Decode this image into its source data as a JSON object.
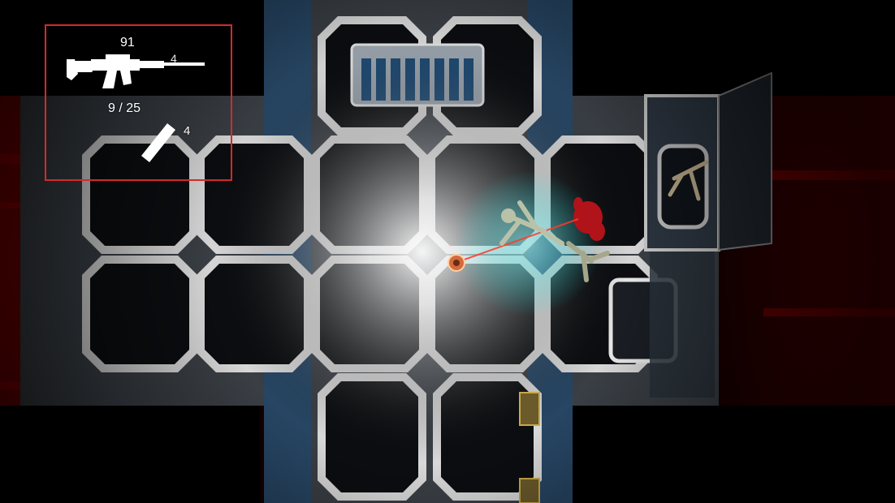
{
  "hud": {
    "reserve_ammo": "91",
    "primary_weapon_count": "4",
    "clip_ammo": "9 / 25",
    "melee_count": "4",
    "primary_weapon_icon": "assault-rifle-icon",
    "melee_weapon_icon": "knife-icon",
    "frame_color": "#d42a2a"
  },
  "colors": {
    "void_red": "#8a0000",
    "floor_metal": "#c9c9c9",
    "panel_blue": "#23527a",
    "laser": "#ff3a2a"
  }
}
